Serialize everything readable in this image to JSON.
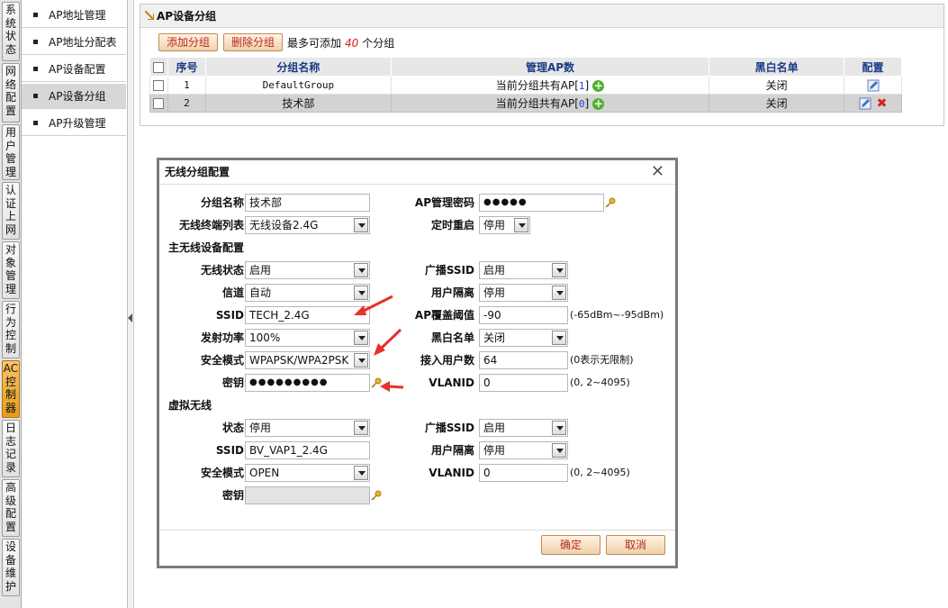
{
  "nav": {
    "tabs": [
      {
        "label": "系统状态"
      },
      {
        "label": "网络配置"
      },
      {
        "label": "用户管理"
      },
      {
        "label": "认证上网"
      },
      {
        "label": "对象管理"
      },
      {
        "label": "行为控制"
      },
      {
        "label": "AC控制器"
      },
      {
        "label": "日志记录"
      },
      {
        "label": "高级配置"
      },
      {
        "label": "设备维护"
      }
    ],
    "active_tab": "AC控制器",
    "sub_items": [
      {
        "label": "AP地址管理"
      },
      {
        "label": "AP地址分配表"
      },
      {
        "label": "AP设备配置"
      },
      {
        "label": "AP设备分组"
      },
      {
        "label": "AP升级管理"
      }
    ],
    "active_sub": "AP设备分组"
  },
  "panel": {
    "title": "AP设备分组",
    "add_label": "添加分组",
    "delete_label": "删除分组",
    "limit_prefix": "最多可添加",
    "limit_value": "40",
    "limit_suffix": "个分组",
    "columns": [
      "序号",
      "分组名称",
      "管理AP数",
      "黑白名单",
      "配置"
    ],
    "rows": [
      {
        "index": "1",
        "name": "DefaultGroup",
        "ap_prefix": "当前分组共有AP[",
        "ap_count": "1",
        "ap_suffix": "]",
        "list": "关闭"
      },
      {
        "index": "2",
        "name": "技术部",
        "ap_prefix": "当前分组共有AP[",
        "ap_count": "0",
        "ap_suffix": "]",
        "list": "关闭"
      }
    ]
  },
  "dialog": {
    "title": "无线分组配置",
    "group_name_label": "分组名称",
    "group_name_value": "技术部",
    "terminal_list_label": "无线终端列表",
    "terminal_list_value": "无线设备2.4G",
    "ap_password_label": "AP管理密码",
    "ap_password_value": "●●●●●",
    "reboot_label": "定时重启",
    "reboot_value": "停用",
    "main_section": "主无线设备配置",
    "wireless_status_label": "无线状态",
    "wireless_status_value": "启用",
    "channel_label": "信道",
    "channel_value": "自动",
    "ssid_label": "SSID",
    "ssid_value": "TECH_2.4G",
    "power_label": "发射功率",
    "power_value": "100%",
    "security_label": "安全模式",
    "security_value": "WPAPSK/WPA2PSK",
    "key_label": "密钥",
    "key_value": "●●●●●●●●●",
    "broadcast_label": "广播SSID",
    "broadcast_value": "启用",
    "isolation_label": "用户隔离",
    "isolation_value": "停用",
    "threshold_label": "AP覆盖阈值",
    "threshold_value": "-90",
    "threshold_hint": "(-65dBm~-95dBm)",
    "bw_label": "黑白名单",
    "bw_value": "关闭",
    "users_label": "接入用户数",
    "users_value": "64",
    "users_hint": "(0表示无限制)",
    "vlan_label": "VLANID",
    "vlan_value": "0",
    "vlan_hint": "(0, 2~4095)",
    "virtual_section": "虚拟无线",
    "v_status_label": "状态",
    "v_status_value": "停用",
    "v_ssid_label": "SSID",
    "v_ssid_value": "BV_VAP1_2.4G",
    "v_security_label": "安全模式",
    "v_security_value": "OPEN",
    "v_key_label": "密钥",
    "v_key_value": "",
    "v_broadcast_label": "广播SSID",
    "v_broadcast_value": "启用",
    "v_isolation_label": "用户隔离",
    "v_isolation_value": "停用",
    "v_vlan_label": "VLANID",
    "v_vlan_value": "0",
    "v_vlan_hint": "(0, 2~4095)",
    "ok_label": "确定",
    "cancel_label": "取消"
  },
  "colors": {
    "accent": "#e39c1c",
    "header_text": "#1a3b87",
    "button_text": "#c0271b",
    "annotation_arrow": "#e8312a"
  }
}
